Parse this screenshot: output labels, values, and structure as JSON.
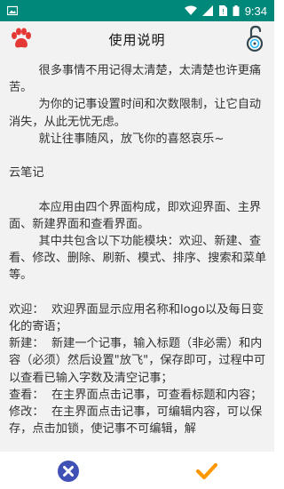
{
  "status_bar": {
    "time": "9:34",
    "icons": [
      "image-icon",
      "wifi-icon",
      "cellular-signal-icon",
      "no-sim-icon",
      "battery-icon"
    ]
  },
  "header": {
    "title": "使用说明",
    "left_icon": "paw-icon",
    "right_icon": "lock-icon"
  },
  "content": {
    "paragraphs": [
      "        很多事情不用记得太清楚，太清楚也许更痛苦。",
      "        为你的记事设置时间和次数限制，让它自动消失，从此无忧无虑。",
      "        就让往事随风，放飞你的喜怒哀乐~",
      "",
      "云笔记",
      "",
      "        本应用由四个界面构成，即欢迎界面、主界面、新建界面和查看界面。",
      "        其中共包含以下功能模块：欢迎、新建、查看、修改、删除、刷新、模式、排序、搜索和菜单等。",
      "",
      "欢迎：  欢迎界面显示应用名称和logo以及每日变化的寄语；",
      "新建：  新建一个记事，输入标题（非必需）和内容（必须）然后设置\"放飞\"，保存即可，过程中可以查看已输入字数及清空记事；",
      "查看：  在主界面点击记事，可查看标题和内容；",
      "修改：  在主界面点击记事，可编辑内容，可以保存，点击加锁，使记事不可编辑，解"
    ]
  },
  "bottom_bar": {
    "cancel_icon": "close-icon",
    "confirm_icon": "check-icon"
  },
  "colors": {
    "status_bar": "#00897B",
    "app_background": "#f2f2f2",
    "paw": "#e53935",
    "cancel_button": "#3f51b5",
    "confirm_button": "#ff9800"
  }
}
